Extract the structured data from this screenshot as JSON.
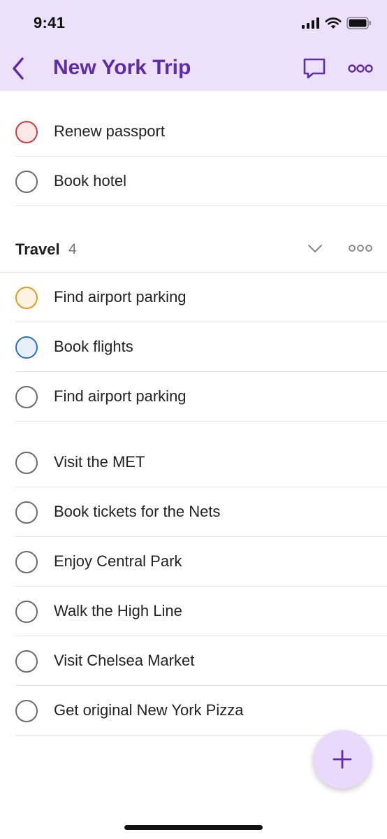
{
  "status_bar": {
    "time": "9:41"
  },
  "header": {
    "title": "New York Trip"
  },
  "colors": {
    "accent": "#5c2da6",
    "header_bg": "#ece0fb"
  },
  "tasks_top": [
    {
      "label": "Renew passport",
      "priority": "red"
    },
    {
      "label": "Book hotel",
      "priority": "none"
    }
  ],
  "section": {
    "title": "Travel",
    "count": "4"
  },
  "tasks_travel": [
    {
      "label": "Find airport parking",
      "priority": "orange"
    },
    {
      "label": "Book flights",
      "priority": "blue"
    },
    {
      "label": "Find airport parking",
      "priority": "none"
    }
  ],
  "tasks_bottom": [
    {
      "label": "Visit the MET"
    },
    {
      "label": "Book tickets for the Nets"
    },
    {
      "label": "Enjoy Central Park"
    },
    {
      "label": "Walk the High Line"
    },
    {
      "label": "Visit Chelsea Market"
    },
    {
      "label": "Get original New York Pizza"
    }
  ],
  "icons": {
    "back": "chevron-left-icon",
    "comment": "comment-icon",
    "more": "more-horizontal-icon",
    "collapse": "chevron-down-icon",
    "add": "plus-icon"
  }
}
